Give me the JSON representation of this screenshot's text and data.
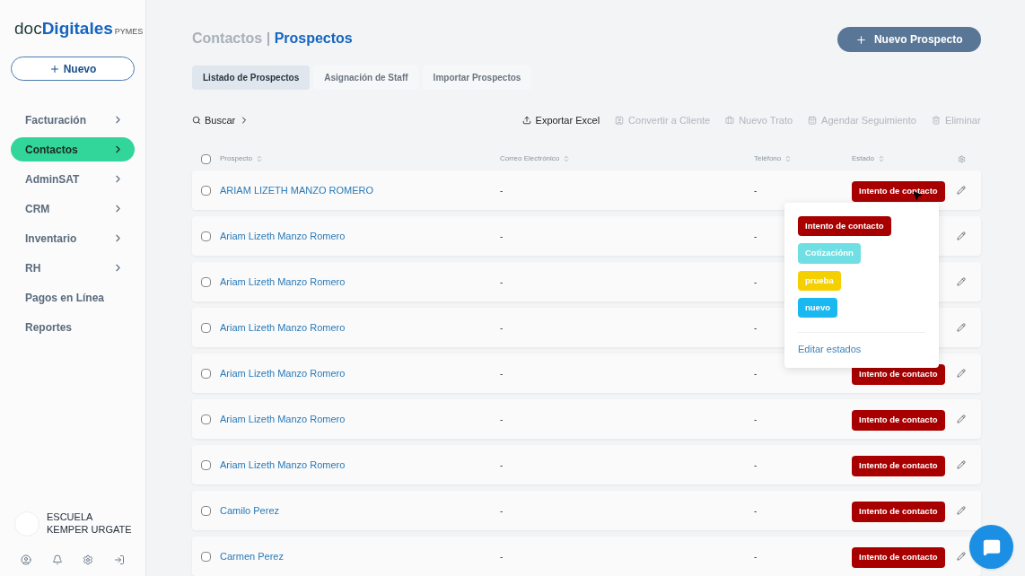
{
  "logo": {
    "light": "doc",
    "bold": "Digitales",
    "suffix": "PYMES"
  },
  "new_button": {
    "label": "Nuevo"
  },
  "menu": [
    {
      "label": "Facturación",
      "kind": "group",
      "selected": false
    },
    {
      "label": "Contactos",
      "kind": "group",
      "selected": true
    },
    {
      "label": "AdminSAT",
      "kind": "group",
      "selected": false
    },
    {
      "label": "CRM",
      "kind": "group",
      "selected": false
    },
    {
      "label": "Inventario",
      "kind": "group",
      "selected": false
    },
    {
      "label": "RH",
      "kind": "group",
      "selected": false
    },
    {
      "label": "Pagos en Línea",
      "kind": "link",
      "selected": false
    },
    {
      "label": "Reportes",
      "kind": "link",
      "selected": false
    }
  ],
  "account": {
    "name": "ESCUELA KEMPER URGATE"
  },
  "breadcrumb": {
    "parent": "Contactos",
    "separator": "|",
    "current": "Prospectos"
  },
  "primary_button": {
    "label": "Nuevo Prospecto"
  },
  "tabs": [
    {
      "label": "Listado de Prospectos",
      "selected": true
    },
    {
      "label": "Asignación de Staff",
      "selected": false
    },
    {
      "label": "Importar Prospectos",
      "selected": false
    }
  ],
  "search": {
    "label": "Buscar"
  },
  "actions": [
    {
      "label": "Exportar Excel",
      "kind": "export",
      "disabled": false
    },
    {
      "label": "Convertir a Cliente",
      "kind": "convert",
      "disabled": true
    },
    {
      "label": "Nuevo Trato",
      "kind": "deal",
      "disabled": true
    },
    {
      "label": "Agendar Seguimiento",
      "kind": "schedule",
      "disabled": true
    },
    {
      "label": "Eliminar",
      "kind": "delete",
      "disabled": true
    }
  ],
  "table": {
    "all_checked": false,
    "columns": [
      "Prospecto",
      "Correo Electrónico",
      "Teléfono",
      "Estado"
    ],
    "rows": [
      {
        "name": "ARIAM LIZETH MANZO ROMERO",
        "email": "-",
        "phone": "-",
        "status": {
          "label": "Intento de contacto",
          "color": "#a80000"
        },
        "checked": false
      },
      {
        "name": "Ariam Lizeth Manzo Romero",
        "email": "-",
        "phone": "-",
        "checked": false
      },
      {
        "name": "Ariam Lizeth Manzo Romero",
        "email": "-",
        "phone": "-",
        "checked": false
      },
      {
        "name": "Ariam Lizeth Manzo Romero",
        "email": "-",
        "phone": "-",
        "checked": false
      },
      {
        "name": "Ariam Lizeth Manzo Romero",
        "email": "-",
        "phone": "-",
        "status": {
          "label": "Intento de contacto",
          "color": "#a80000"
        },
        "checked": false
      },
      {
        "name": "Ariam Lizeth Manzo Romero",
        "email": "-",
        "phone": "-",
        "status": {
          "label": "Intento de contacto",
          "color": "#a80000"
        },
        "checked": false
      },
      {
        "name": "Ariam Lizeth Manzo Romero",
        "email": "-",
        "phone": "-",
        "status": {
          "label": "Intento de contacto",
          "color": "#a80000"
        },
        "checked": false
      },
      {
        "name": "Camilo Perez",
        "email": "-",
        "phone": "-",
        "status": {
          "label": "Intento de contacto",
          "color": "#a80000"
        },
        "checked": false
      },
      {
        "name": "Carmen Perez",
        "email": "-",
        "phone": "-",
        "status": {
          "label": "Intento de contacto",
          "color": "#a80000"
        },
        "checked": false
      }
    ]
  },
  "status_menu": {
    "options": [
      {
        "label": "Intento de contacto",
        "color": "#a80000"
      },
      {
        "label": "Cotizaciónn",
        "color": "#6fdfe3"
      },
      {
        "label": "prueba",
        "color": "#f5d000"
      },
      {
        "label": "nuevo",
        "color": "#1ab8f0"
      }
    ],
    "edit_link": "Editar estados"
  }
}
